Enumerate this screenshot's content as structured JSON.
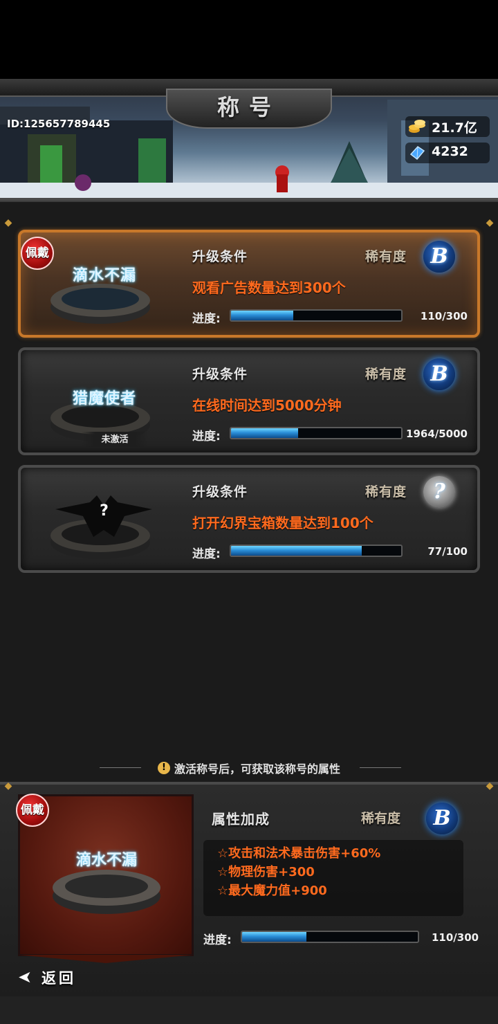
{
  "header": {
    "title": "称号",
    "player_id": "ID:125657789445",
    "gold": "21.7亿",
    "gems": "4232"
  },
  "titles": [
    {
      "name": "滴水不漏",
      "equipped_badge": "佩戴",
      "condition_label": "升级条件",
      "rarity_label": "稀有度",
      "rarity": "B",
      "requirement": "观看广告数量达到300个",
      "progress_label": "进度:",
      "progress_text": "110/300",
      "progress_fraction": 0.367
    },
    {
      "name": "猎魔使者",
      "inactive_tag": "未激活",
      "condition_label": "升级条件",
      "rarity_label": "稀有度",
      "rarity": "B",
      "requirement": "在线时间达到5000分钟",
      "progress_label": "进度:",
      "progress_text": "1964/5000",
      "progress_fraction": 0.393
    },
    {
      "name": "?",
      "condition_label": "升级条件",
      "rarity_label": "稀有度",
      "rarity": "?",
      "requirement": "打开幻界宝箱数量达到100个",
      "progress_label": "进度:",
      "progress_text": "77/100",
      "progress_fraction": 0.77
    }
  ],
  "hint": "激活称号后，可获取该称号的属性",
  "detail": {
    "equipped_badge": "佩戴",
    "name": "滴水不漏",
    "bonus_title": "属性加成",
    "rarity_label": "稀有度",
    "rarity": "B",
    "attributes": [
      "☆攻击和法术暴击伤害+60%",
      "☆物理伤害+300",
      "☆最大魔力值+900"
    ],
    "progress_label": "进度:",
    "progress_text": "110/300",
    "progress_fraction": 0.367
  },
  "back_label": "返回",
  "icons": {
    "gold": "gold-coins-icon",
    "gem": "blue-gem-icon",
    "warning": "warning-icon",
    "back": "back-arrow-icon"
  },
  "colors": {
    "requirement": "#ff6a1e",
    "active_border": "#c8782a",
    "progress_fill": "#2b8fd8"
  }
}
